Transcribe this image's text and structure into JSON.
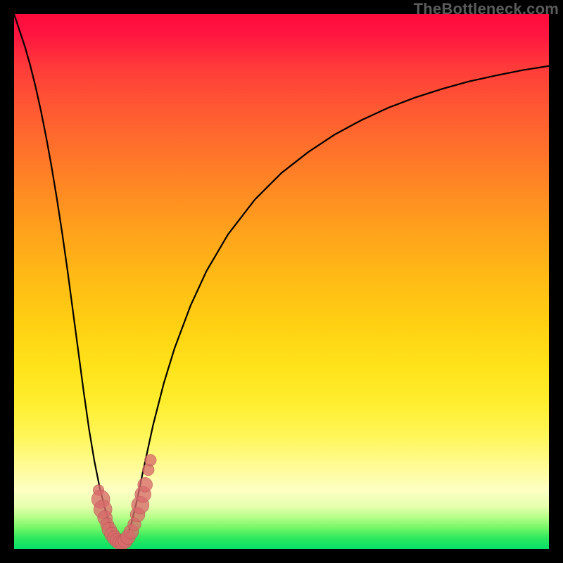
{
  "watermark": "TheBottleneck.com",
  "colors": {
    "frame": "#000000",
    "curve": "#000000",
    "point_fill": "#d76a6a",
    "gradient_top": "#ff0a3c",
    "gradient_bottom": "#06e06a"
  },
  "chart_data": {
    "type": "line",
    "title": "",
    "xlabel": "",
    "ylabel": "",
    "xlim": [
      0,
      100
    ],
    "ylim": [
      0,
      100
    ],
    "curve_minimum_x": 20,
    "x": [
      0,
      1,
      2,
      3,
      4,
      5,
      6,
      7,
      8,
      9,
      10,
      11,
      12,
      13,
      14,
      15,
      16,
      17,
      18,
      19,
      19.5,
      20,
      20.5,
      21,
      22,
      23,
      24,
      26,
      28,
      30,
      33,
      36,
      40,
      45,
      50,
      55,
      60,
      65,
      70,
      75,
      80,
      85,
      90,
      95,
      100
    ],
    "y": [
      100,
      97,
      94,
      90.5,
      86.5,
      82,
      77,
      71.5,
      65.5,
      59,
      52,
      44.5,
      37,
      29.5,
      22.5,
      16.5,
      11.5,
      7.5,
      4.2,
      2,
      1.2,
      1,
      1.2,
      2,
      5,
      9.2,
      14,
      23.2,
      31,
      37.5,
      45.5,
      52,
      58.8,
      65.3,
      70.3,
      74.2,
      77.5,
      80.2,
      82.5,
      84.4,
      86,
      87.4,
      88.5,
      89.5,
      90.3
    ],
    "scatter_points": [
      {
        "x": 15.8,
        "y": 11.0,
        "r": 1.5
      },
      {
        "x": 16.2,
        "y": 9.3,
        "r": 2.5
      },
      {
        "x": 16.6,
        "y": 7.4,
        "r": 2.5
      },
      {
        "x": 17.0,
        "y": 5.8,
        "r": 2.0
      },
      {
        "x": 17.4,
        "y": 4.6,
        "r": 1.8
      },
      {
        "x": 17.8,
        "y": 3.6,
        "r": 2.0
      },
      {
        "x": 18.3,
        "y": 2.7,
        "r": 2.0
      },
      {
        "x": 18.8,
        "y": 2.0,
        "r": 2.0
      },
      {
        "x": 19.3,
        "y": 1.5,
        "r": 2.0
      },
      {
        "x": 19.8,
        "y": 1.2,
        "r": 2.0
      },
      {
        "x": 20.3,
        "y": 1.2,
        "r": 2.0
      },
      {
        "x": 20.8,
        "y": 1.5,
        "r": 2.0
      },
      {
        "x": 21.3,
        "y": 2.2,
        "r": 2.0
      },
      {
        "x": 21.9,
        "y": 3.2,
        "r": 2.0
      },
      {
        "x": 22.5,
        "y": 4.6,
        "r": 1.8
      },
      {
        "x": 23.1,
        "y": 6.4,
        "r": 2.0
      },
      {
        "x": 23.6,
        "y": 8.2,
        "r": 2.4
      },
      {
        "x": 24.1,
        "y": 10.2,
        "r": 2.2
      },
      {
        "x": 24.5,
        "y": 12.0,
        "r": 2.0
      },
      {
        "x": 25.1,
        "y": 14.8,
        "r": 1.6
      },
      {
        "x": 25.5,
        "y": 16.6,
        "r": 1.6
      }
    ]
  }
}
